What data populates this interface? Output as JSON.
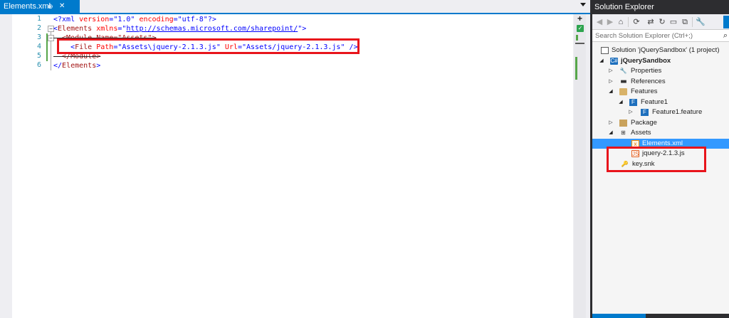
{
  "editor": {
    "tab": {
      "title": "Elements.xml",
      "pin_glyph": "⊕",
      "close_glyph": "✕"
    },
    "line_numbers": [
      "1",
      "2",
      "3",
      "4",
      "5",
      "6"
    ],
    "lines": [
      {
        "open": "<?xml ",
        "attr1": "version",
        "eq1": "=",
        "val1": "\"1.0\"",
        "sp": " ",
        "attr2": "encoding",
        "eq2": "=",
        "val2": "\"utf-8\"",
        "close": "?>"
      },
      {
        "open": "<",
        "tag": "Elements",
        "sp": " ",
        "attr": "xmlns",
        "eq": "=\"",
        "link": "http://schemas.microsoft.com/sharepoint/",
        "close": "\">"
      },
      {
        "text": "  <Module Name=\"Assets\">"
      },
      {
        "open": "    <",
        "tag": "File",
        "sp1": " ",
        "attr1": "Path",
        "eq1": "=",
        "val1": "\"Assets\\jquery-2.1.3.js\"",
        "sp2": " ",
        "attr2": "Url",
        "eq2": "=",
        "val2": "\"Assets/jquery-2.1.3.js\"",
        "close": " />"
      },
      {
        "text": "  </Module>"
      },
      {
        "open": "</",
        "tag": "Elements",
        "close": ">"
      }
    ],
    "split_glyph": "+",
    "status_glyph": "✓"
  },
  "solution_explorer": {
    "title": "Solution Explorer",
    "toolbar": [
      {
        "icon": "back-icon",
        "glyph": "◀"
      },
      {
        "icon": "forward-icon",
        "glyph": "▶"
      },
      {
        "icon": "home-icon",
        "glyph": "⌂"
      },
      {
        "icon": "sync-icon",
        "glyph": "⟳"
      },
      {
        "icon": "pending-changes-icon",
        "glyph": "⇄"
      },
      {
        "icon": "refresh-icon",
        "glyph": "↻"
      },
      {
        "icon": "collapse-all-icon",
        "glyph": "▭"
      },
      {
        "icon": "show-all-files-icon",
        "glyph": "⧉"
      },
      {
        "icon": "properties-icon",
        "glyph": "🔧"
      }
    ],
    "search_placeholder": "Search Solution Explorer (Ctrl+;)",
    "tree": [
      {
        "label": "Solution 'jQuerySandbox' (1 project)",
        "icon": "solution-icon",
        "glyph": "",
        "expander": ""
      },
      {
        "label": "jQuerySandbox",
        "icon": "project-icon",
        "glyph": "C#",
        "expander": "◢"
      },
      {
        "label": "Properties",
        "icon": "wrench-icon",
        "glyph": "🔧",
        "expander": "▷"
      },
      {
        "label": "References",
        "icon": "references-icon",
        "glyph": "■■",
        "expander": "▷"
      },
      {
        "label": "Features",
        "icon": "folder-icon",
        "glyph": "",
        "expander": "◢"
      },
      {
        "label": "Feature1",
        "icon": "feature-icon",
        "glyph": "F",
        "expander": "◢"
      },
      {
        "label": "Feature1.feature",
        "icon": "feature-icon",
        "glyph": "F",
        "expander": "▷"
      },
      {
        "label": "Package",
        "icon": "package-icon",
        "glyph": "",
        "expander": "▷"
      },
      {
        "label": "Assets",
        "icon": "assets-icon",
        "glyph": "⊞",
        "expander": "◢"
      },
      {
        "label": "Elements.xml",
        "icon": "xml-file-icon",
        "glyph": "x",
        "expander": ""
      },
      {
        "label": "jquery-2.1.3.js",
        "icon": "js-file-icon",
        "glyph": "JS",
        "expander": ""
      },
      {
        "label": "key.snk",
        "icon": "key-icon",
        "glyph": "🔑",
        "expander": ""
      }
    ]
  },
  "colors": {
    "accent": "#007acc",
    "highlight_red": "#e8141b",
    "selection": "#3399ff"
  }
}
